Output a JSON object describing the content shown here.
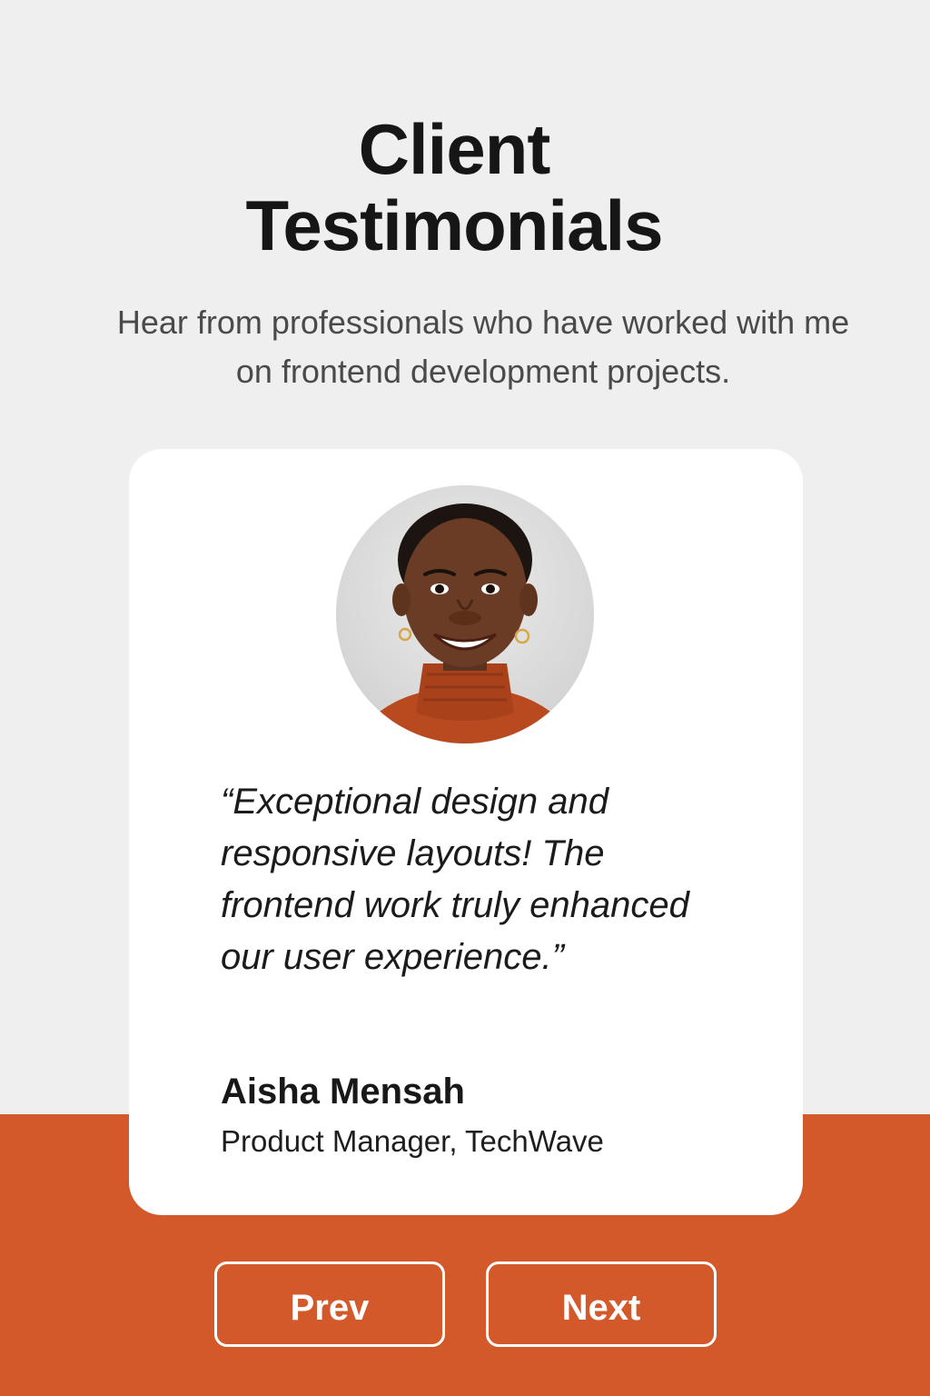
{
  "header": {
    "title_line1": "Client",
    "title_line2": "Testimonials",
    "subtitle": "Hear from professionals who have worked with me on frontend development projects."
  },
  "testimonial": {
    "quote": "“Exceptional design and responsive layouts! The frontend work truly enhanced our user experience.”",
    "author_name": "Aisha Mensah",
    "author_role": "Product Manager, TechWave"
  },
  "navigation": {
    "prev_label": "Prev",
    "next_label": "Next"
  },
  "colors": {
    "accent": "#d4592a",
    "background": "#efefef",
    "card": "#ffffff",
    "text": "#161616"
  }
}
